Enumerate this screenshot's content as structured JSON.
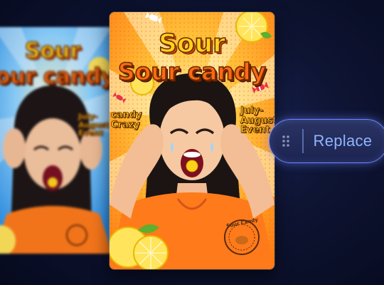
{
  "poster": {
    "title_line1": "Sour",
    "title_line2": "Sour candy",
    "left_tag": [
      "candy",
      "Crazy"
    ],
    "right_tag": [
      "July-",
      "August",
      "Event"
    ],
    "badge": "Sour Candy"
  },
  "poster_back": {
    "title_line1": "Sour",
    "title_line2": "Sour candy",
    "right_tag": [
      "July-",
      "August",
      "Event"
    ]
  },
  "toolbar": {
    "replace_label": "Replace",
    "drag_icon": "drag-handle-icon"
  },
  "colors": {
    "background": "#0e1433",
    "accent_border": "#6e86ff",
    "replace_text": "#8fb4ff",
    "poster_orange": "#ff7a1a",
    "poster_yellow": "#ffd21a"
  }
}
